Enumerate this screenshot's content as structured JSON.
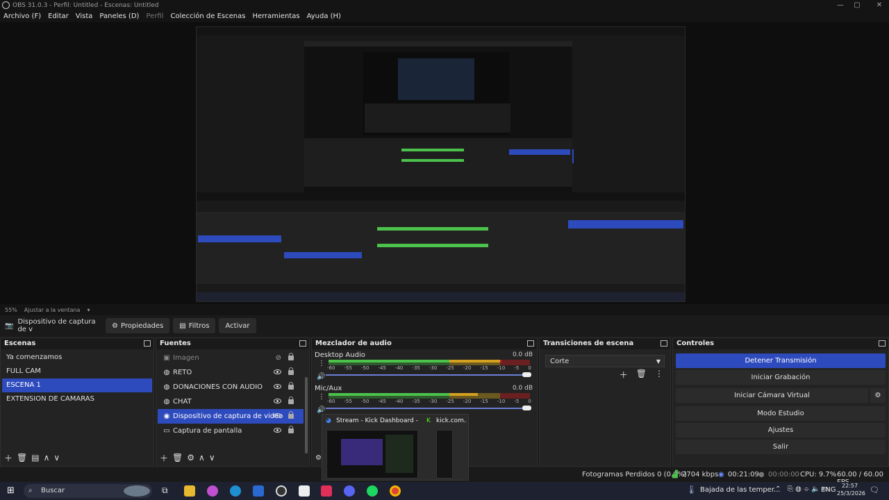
{
  "window": {
    "title": "OBS 31.0.3 - Perfil: Untitled - Escenas: Untitled",
    "minimize": "—",
    "maximize": "▢",
    "close": "✕"
  },
  "menu": [
    "Archivo (F)",
    "Editar",
    "Vista",
    "Paneles (D)",
    "Perfil",
    "Colección de Escenas",
    "Herramientas",
    "Ayuda (H)"
  ],
  "preview": {
    "zoom": "55%",
    "fit": "Ajustar a la ventana"
  },
  "context": {
    "source": "Dispositivo de captura de v",
    "properties": "Propiedades",
    "filters": "Filtros",
    "activate": "Activar"
  },
  "scenes": {
    "title": "Escenas",
    "items": [
      "Ya comenzamos",
      "FULL CAM",
      "ESCENA 1",
      "EXTENSION DE CAMARAS"
    ],
    "selected": 2
  },
  "sources": {
    "title": "Fuentes",
    "items": [
      {
        "label": "Imagen",
        "icon": "image-icon"
      },
      {
        "label": "RETO",
        "icon": "browser-icon"
      },
      {
        "label": "DONACIONES CON AUDIO",
        "icon": "browser-icon"
      },
      {
        "label": "CHAT",
        "icon": "browser-icon"
      },
      {
        "label": "Dispositivo de captura de video",
        "icon": "camera-icon"
      },
      {
        "label": "Captura de pantalla",
        "icon": "monitor-icon"
      }
    ],
    "selected": 4
  },
  "mixer": {
    "title": "Mezclador de audio",
    "channels": [
      {
        "name": "Desktop Audio",
        "db": "0.0 dB",
        "level": 0.86
      },
      {
        "name": "Mic/Aux",
        "db": "0.0 dB",
        "level": 0.74
      }
    ],
    "ticks": [
      "-60",
      "-55",
      "-50",
      "-45",
      "-40",
      "-35",
      "-30",
      "-25",
      "-20",
      "-15",
      "-10",
      "-5",
      "0"
    ]
  },
  "transitions": {
    "title": "Transiciones de escena",
    "current": "Corte"
  },
  "controls": {
    "title": "Controles",
    "buttons": [
      "Detener Transmisión",
      "Iniciar Grabación",
      "Iniciar Cámara Virtual",
      "Modo Estudio",
      "Ajustes",
      "Salir"
    ]
  },
  "status": {
    "dropped": "Fotogramas Perdidos 0 (0.0%)",
    "bitrate": "2704 kbps",
    "stream_time": "00:21:09",
    "rec_time": "00:00:00",
    "cpu": "CPU: 9.7%",
    "fps": "60.00 / 60.00 FPS"
  },
  "popup": {
    "tab1": "Stream - Kick Dashboard - Goo...",
    "tab2": "kick.com..."
  },
  "taskbar": {
    "search": "Buscar",
    "weather": "Bajada de las temper...",
    "lang": "ENG",
    "time": "22:57",
    "date": "25/3/2026"
  },
  "colors": {
    "accent": "#2e4bbd",
    "meter_green": "#4cc24c",
    "meter_yellow": "#d4a020",
    "meter_red": "#c02020"
  }
}
